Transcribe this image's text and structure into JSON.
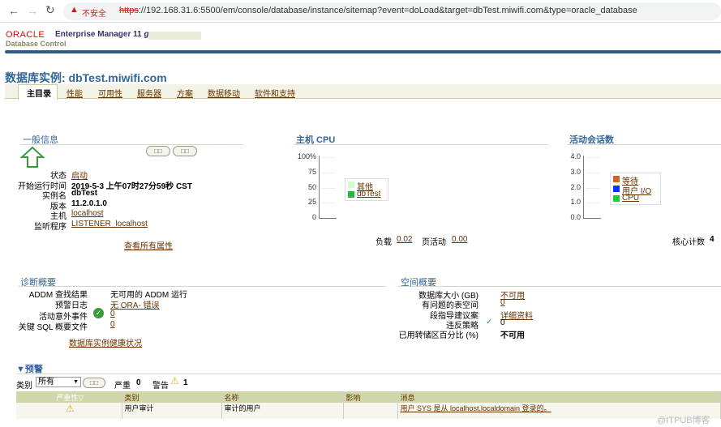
{
  "browser": {
    "warning": "不安全",
    "url_scheme": "https",
    "url_rest": "://192.168.31.6:5500/em/console/database/instance/sitemap?event=doLoad&target=dbTest.miwifi.com&type=oracle_database"
  },
  "brand": {
    "oracle": "ORACLE",
    "product": "Enterprise Manager 11",
    "g": "g",
    "sub": "Database Control"
  },
  "page_title": "数据库实例: dbTest.miwifi.com",
  "tabs": [
    "主目录",
    "性能",
    "可用性",
    "服务器",
    "方案",
    "数据移动",
    "软件和支持"
  ],
  "general": {
    "title": "一般信息",
    "btn1": "□□",
    "btn2": "□□",
    "rows": [
      {
        "label": "状态",
        "value": "启动",
        "link": true
      },
      {
        "label": "开始运行时间",
        "value": "2019-5-3 上午07时27分59秒 CST",
        "link": false
      },
      {
        "label": "实例名",
        "value": "dbTest",
        "link": false
      },
      {
        "label": "版本",
        "value": "11.2.0.1.0",
        "link": false
      },
      {
        "label": "主机",
        "value": "localhost",
        "link": true
      },
      {
        "label": "监听程序",
        "value": "LISTENER_localhost",
        "link": true
      }
    ],
    "view_all": "查看所有属性"
  },
  "cpu": {
    "title": "主机 CPU",
    "load_label": "负载",
    "load": "0.02",
    "paging_label": "页活动",
    "paging": "0.00"
  },
  "sessions": {
    "title": "活动会话数",
    "cores_label": "核心计数",
    "cores": "4"
  },
  "chart_data": [
    {
      "type": "area",
      "title": "主机 CPU",
      "yticks": [
        "100%",
        "75",
        "50",
        "25",
        "0"
      ],
      "ylim": [
        0,
        100
      ],
      "legend": [
        {
          "name": "其他",
          "color": "#ccffcc"
        },
        {
          "name": "dbTest",
          "color": "#22bb33"
        }
      ],
      "series": [
        {
          "name": "其他",
          "values": [
            0
          ]
        },
        {
          "name": "dbTest",
          "values": [
            0
          ]
        }
      ]
    },
    {
      "type": "area",
      "title": "活动会话数",
      "yticks": [
        "4.0",
        "3.0",
        "2.0",
        "1.0",
        "0.0"
      ],
      "ylim": [
        0,
        4
      ],
      "legend": [
        {
          "name": "等待",
          "color": "#cc6622"
        },
        {
          "name": "用户 I/O",
          "color": "#1133ee"
        },
        {
          "name": "CPU",
          "color": "#22cc33"
        }
      ],
      "series": [
        {
          "name": "等待",
          "values": [
            0
          ]
        },
        {
          "name": "用户 I/O",
          "values": [
            0
          ]
        },
        {
          "name": "CPU",
          "values": [
            0
          ]
        }
      ]
    }
  ],
  "diag": {
    "title": "诊断概要",
    "rows": [
      {
        "label": "ADDM 查找结果",
        "value": "无可用的 ADDM 运行"
      },
      {
        "label": "预警日志",
        "value": "无 ORA- 错误"
      },
      {
        "label": "活动意外事件",
        "value": "0"
      },
      {
        "label": "关键 SQL 概要文件",
        "value": "0"
      }
    ],
    "health": "数据库实例健康状况"
  },
  "space": {
    "title": "空间概要",
    "rows": [
      {
        "label": "数据库大小 (GB)",
        "value": "不可用"
      },
      {
        "label": "有问题的表空间",
        "value": "0"
      },
      {
        "label": "段指导建议案",
        "value": "详细资料"
      },
      {
        "label": "违反策略",
        "value": "0"
      },
      {
        "label": "已用转储区百分比 (%)",
        "value": "不可用"
      }
    ]
  },
  "alerts": {
    "title": "▼预警",
    "category_label": "类别",
    "category": "所有",
    "go": "□□",
    "critical_label": "严重",
    "critical": "0",
    "warning_label": "警告",
    "warning": "1",
    "columns": [
      "严重性▽",
      "类别",
      "名称",
      "影响",
      "消息"
    ],
    "rows": [
      {
        "category": "用户审计",
        "name": "审计的用户",
        "impact": "",
        "message": "用户 SYS 是从 localhost.localdomain 登录的。"
      }
    ]
  },
  "watermark": "@ITPUB博客"
}
